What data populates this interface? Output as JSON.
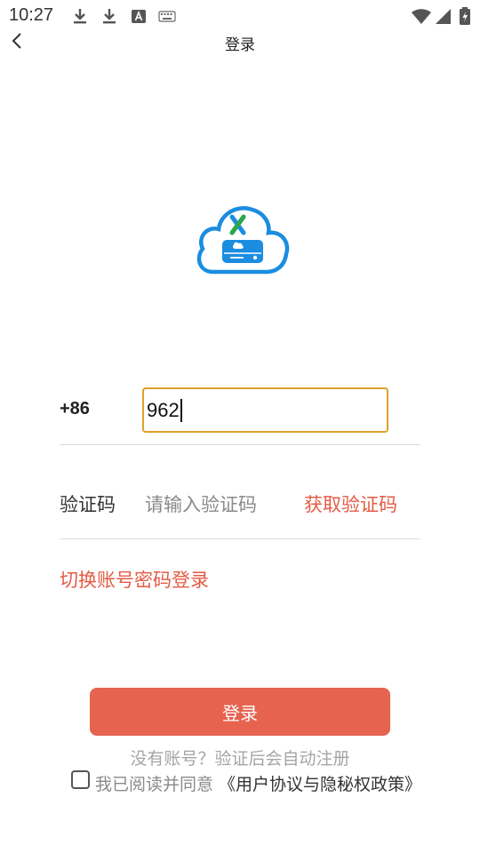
{
  "status_bar": {
    "time": "10:27",
    "icons": [
      "download-icon",
      "download-icon",
      "font-a-icon",
      "keyboard-icon",
      "wifi-icon",
      "signal-icon",
      "battery-icon"
    ]
  },
  "header": {
    "title": "登录",
    "back_icon": "chevron-left-icon"
  },
  "logo": {
    "icon": "cloud-storage-logo-icon",
    "colors": {
      "blue": "#1a8de0",
      "green": "#2aa84a"
    }
  },
  "login_form": {
    "country_code": "+86",
    "phone_value": "962",
    "code_label": "验证码",
    "code_placeholder": "请输入验证码",
    "get_code_label": "获取验证码",
    "switch_label": "切换账号密码登录",
    "submit_label": "登录"
  },
  "footer": {
    "register_hint": "没有账号？验证后会自动注册",
    "agree_text": "我已阅读并同意",
    "agreement_link": "《用户协议与隐秘权政策》",
    "checkbox_checked": false
  },
  "colors": {
    "accent": "#e5634f",
    "link": "#e35b45",
    "input_border": "#e0a02a",
    "hint": "#a5a5a5"
  }
}
